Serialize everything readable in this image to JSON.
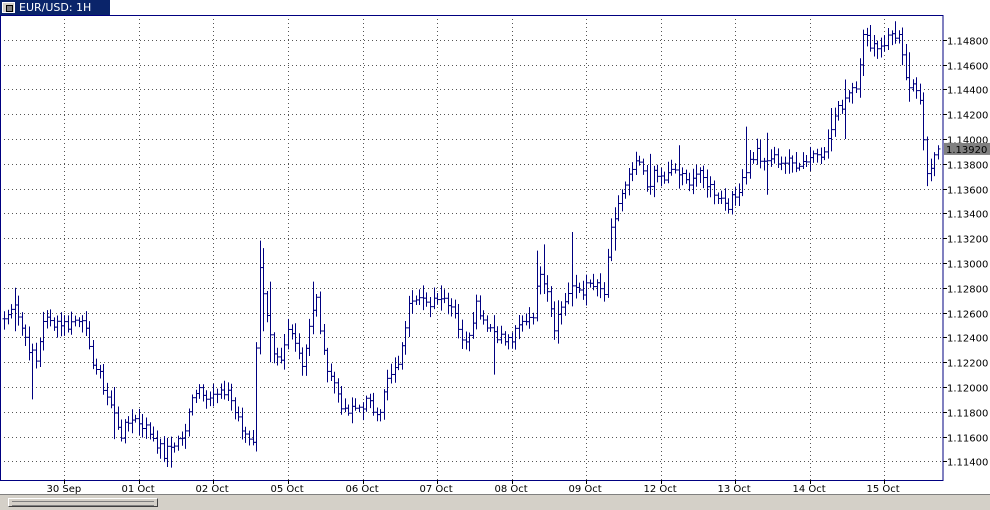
{
  "window": {
    "title": "EUR/USD: 1H",
    "title_bg": "#0a246a",
    "title_fg": "#ffffff"
  },
  "colors": {
    "bars": "#000080",
    "grid": "#555555",
    "frame": "#000080",
    "price_marker_bg": "#808080",
    "price_marker_fg": "#ffffff"
  },
  "chart_data": {
    "type": "ohlc",
    "symbol": "EUR/USD",
    "timeframe": "1H",
    "ylim": [
      1.1125,
      1.15
    ],
    "y_ticks": [
      "1.14800",
      "1.14600",
      "1.14400",
      "1.14200",
      "1.14000",
      "1.13800",
      "1.13600",
      "1.13400",
      "1.13200",
      "1.13000",
      "1.12800",
      "1.12600",
      "1.12400",
      "1.12200",
      "1.12000",
      "1.11800",
      "1.11600",
      "1.11400"
    ],
    "x_ticks": [
      "30 Sep",
      "01 Oct",
      "02 Oct",
      "05 Oct",
      "06 Oct",
      "07 Oct",
      "08 Oct",
      "09 Oct",
      "12 Oct",
      "13 Oct",
      "14 Oct",
      "15 Oct"
    ],
    "x_tick_bar_index": [
      17,
      38,
      59,
      80,
      101,
      122,
      143,
      164,
      185,
      206,
      227,
      248
    ],
    "current_price": "1.13920",
    "current_price_value": 1.1392,
    "bar_count": 264,
    "anchors": [
      [
        0,
        1.1255
      ],
      [
        2,
        1.1262
      ],
      [
        3,
        1.127
      ],
      [
        5,
        1.1248
      ],
      [
        7,
        1.1232
      ],
      [
        9,
        1.122
      ],
      [
        11,
        1.1255
      ],
      [
        13,
        1.1252
      ],
      [
        15,
        1.1253
      ],
      [
        18,
        1.125
      ],
      [
        22,
        1.1258
      ],
      [
        24,
        1.1228
      ],
      [
        27,
        1.1208
      ],
      [
        30,
        1.1185
      ],
      [
        33,
        1.1162
      ],
      [
        36,
        1.1176
      ],
      [
        39,
        1.117
      ],
      [
        42,
        1.116
      ],
      [
        45,
        1.1145
      ],
      [
        48,
        1.1155
      ],
      [
        51,
        1.1162
      ],
      [
        53,
        1.1195
      ],
      [
        55,
        1.12
      ],
      [
        58,
        1.1192
      ],
      [
        61,
        1.1193
      ],
      [
        63,
        1.1198
      ],
      [
        65,
        1.118
      ],
      [
        67,
        1.1165
      ],
      [
        70,
        1.1158
      ],
      [
        72,
        1.13
      ],
      [
        74,
        1.1255
      ],
      [
        76,
        1.1222
      ],
      [
        78,
        1.1218
      ],
      [
        80,
        1.1245
      ],
      [
        82,
        1.124
      ],
      [
        84,
        1.1218
      ],
      [
        86,
        1.125
      ],
      [
        88,
        1.127
      ],
      [
        90,
        1.1225
      ],
      [
        92,
        1.121
      ],
      [
        94,
        1.1195
      ],
      [
        96,
        1.1178
      ],
      [
        99,
        1.1182
      ],
      [
        102,
        1.1188
      ],
      [
        104,
        1.1182
      ],
      [
        106,
        1.1183
      ],
      [
        108,
        1.1205
      ],
      [
        110,
        1.1212
      ],
      [
        112,
        1.123
      ],
      [
        114,
        1.1272
      ],
      [
        116,
        1.1275
      ],
      [
        119,
        1.1265
      ],
      [
        122,
        1.1275
      ],
      [
        125,
        1.127
      ],
      [
        127,
        1.1262
      ],
      [
        129,
        1.1235
      ],
      [
        131,
        1.1245
      ],
      [
        133,
        1.1268
      ],
      [
        135,
        1.1255
      ],
      [
        137,
        1.1248
      ],
      [
        139,
        1.1243
      ],
      [
        141,
        1.1237
      ],
      [
        143,
        1.1238
      ],
      [
        145,
        1.1248
      ],
      [
        147,
        1.1255
      ],
      [
        149,
        1.126
      ],
      [
        151,
        1.1295
      ],
      [
        153,
        1.128
      ],
      [
        155,
        1.125
      ],
      [
        157,
        1.1265
      ],
      [
        159,
        1.1275
      ],
      [
        161,
        1.128
      ],
      [
        163,
        1.1278
      ],
      [
        165,
        1.1282
      ],
      [
        167,
        1.128
      ],
      [
        169,
        1.1275
      ],
      [
        171,
        1.1325
      ],
      [
        173,
        1.1348
      ],
      [
        175,
        1.136
      ],
      [
        177,
        1.1375
      ],
      [
        179,
        1.138
      ],
      [
        181,
        1.1362
      ],
      [
        183,
        1.137
      ],
      [
        186,
        1.1368
      ],
      [
        189,
        1.1375
      ],
      [
        192,
        1.1365
      ],
      [
        195,
        1.1372
      ],
      [
        198,
        1.1365
      ],
      [
        200,
        1.1358
      ],
      [
        202,
        1.1352
      ],
      [
        204,
        1.1348
      ],
      [
        206,
        1.1353
      ],
      [
        208,
        1.137
      ],
      [
        210,
        1.1382
      ],
      [
        212,
        1.139
      ],
      [
        214,
        1.1378
      ],
      [
        216,
        1.1385
      ],
      [
        219,
        1.1382
      ],
      [
        222,
        1.138
      ],
      [
        225,
        1.1382
      ],
      [
        228,
        1.1388
      ],
      [
        230,
        1.139
      ],
      [
        232,
        1.1398
      ],
      [
        234,
        1.1418
      ],
      [
        236,
        1.1428
      ],
      [
        238,
        1.144
      ],
      [
        240,
        1.1445
      ],
      [
        242,
        1.1482
      ],
      [
        244,
        1.1478
      ],
      [
        246,
        1.1475
      ],
      [
        248,
        1.1478
      ],
      [
        250,
        1.1485
      ],
      [
        252,
        1.1483
      ],
      [
        254,
        1.1445
      ],
      [
        256,
        1.144
      ],
      [
        258,
        1.1432
      ],
      [
        260,
        1.1375
      ],
      [
        262,
        1.1385
      ],
      [
        263,
        1.1392
      ]
    ],
    "spikes": [
      [
        3,
        1.128,
        1.1245
      ],
      [
        8,
        1.1235,
        1.119
      ],
      [
        31,
        1.12,
        1.1158
      ],
      [
        47,
        1.116,
        1.1135
      ],
      [
        71,
        1.119,
        1.1148
      ],
      [
        72,
        1.1318,
        1.126
      ],
      [
        73,
        1.1312,
        1.1245
      ],
      [
        75,
        1.1285,
        1.122
      ],
      [
        87,
        1.1285,
        1.1245
      ],
      [
        118,
        1.1282,
        1.1262
      ],
      [
        123,
        1.1282,
        1.1262
      ],
      [
        138,
        1.1258,
        1.121
      ],
      [
        150,
        1.131,
        1.127
      ],
      [
        152,
        1.1315,
        1.1275
      ],
      [
        156,
        1.127,
        1.1235
      ],
      [
        160,
        1.1325,
        1.1265
      ],
      [
        172,
        1.1345,
        1.131
      ],
      [
        182,
        1.1388,
        1.1355
      ],
      [
        190,
        1.1395,
        1.136
      ],
      [
        205,
        1.1345,
        1.1342
      ],
      [
        209,
        1.141,
        1.1365
      ],
      [
        215,
        1.1405,
        1.1355
      ],
      [
        233,
        1.1425,
        1.139
      ],
      [
        237,
        1.1448,
        1.14
      ],
      [
        251,
        1.1495,
        1.1478
      ],
      [
        255,
        1.147,
        1.143
      ],
      [
        260,
        1.1385,
        1.1362
      ]
    ]
  }
}
